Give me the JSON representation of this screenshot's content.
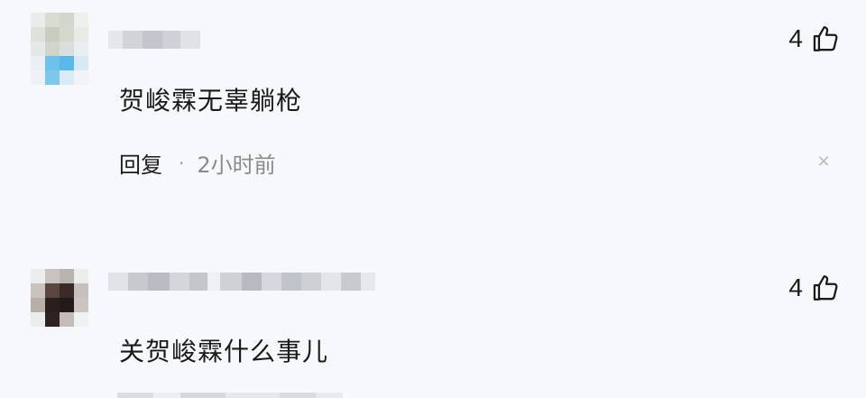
{
  "comments": [
    {
      "username_blurred": true,
      "text": "贺峻霖无辜躺枪",
      "like_count": "4",
      "like_icon": "thumbs-up-icon",
      "reply_label": "回复",
      "dot": "·",
      "time": "2小时前",
      "close_icon": "close-icon",
      "close_glyph": "×"
    },
    {
      "username_blurred": true,
      "text": "关贺峻霖什么事儿",
      "like_count": "4",
      "like_icon": "thumbs-up-icon"
    }
  ],
  "colors": {
    "background": "#f7f8fc",
    "text": "#1a1a1a",
    "meta": "#8a8a8a"
  }
}
